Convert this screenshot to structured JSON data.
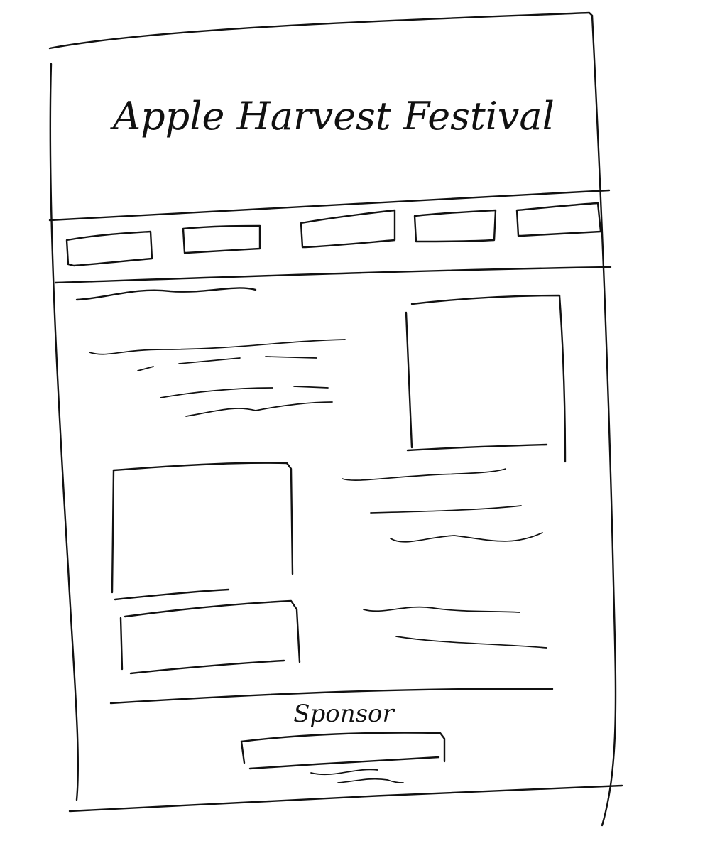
{
  "header": {
    "title": "Apple Harvest Festival"
  },
  "sponsor": {
    "label": "Sponsor"
  }
}
